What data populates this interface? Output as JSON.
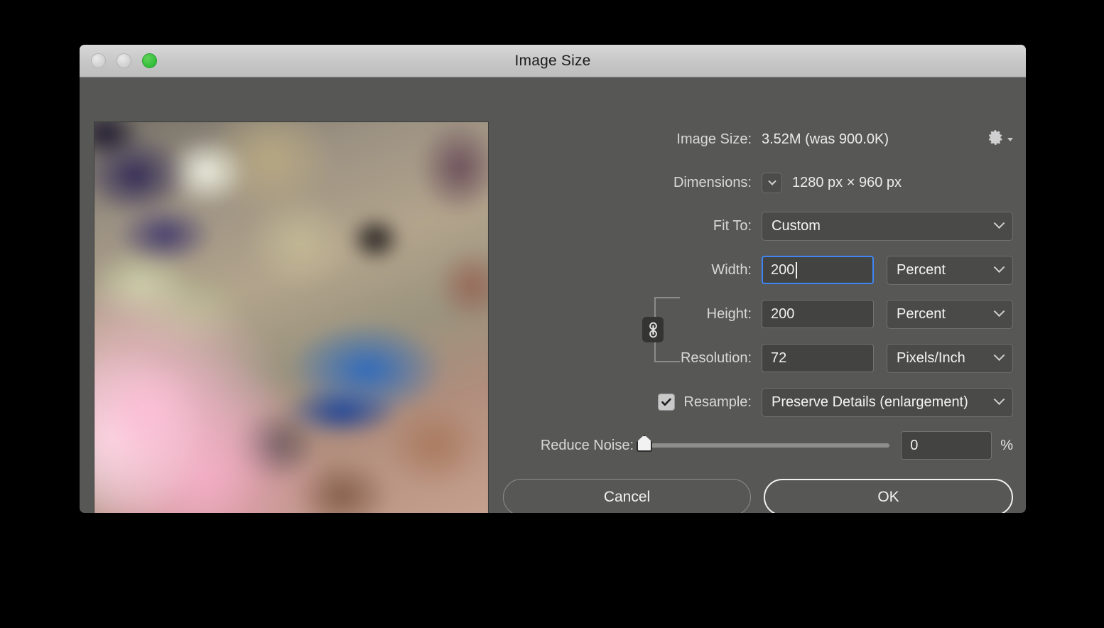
{
  "window": {
    "title": "Image Size",
    "traffic_lights": [
      {
        "name": "close",
        "state": "disabled"
      },
      {
        "name": "minimize",
        "state": "disabled"
      },
      {
        "name": "zoom",
        "state": "green"
      }
    ]
  },
  "info": {
    "image_size_label": "Image Size:",
    "image_size_value": "3.52M (was 900.0K)",
    "dimensions_label": "Dimensions:",
    "dimensions_value": "1280 px  ×  960 px",
    "gear_icon": "gear-icon"
  },
  "form": {
    "fit_to_label": "Fit To:",
    "fit_to_value": "Custom",
    "width_label": "Width:",
    "width_value": "200",
    "width_unit": "Percent",
    "height_label": "Height:",
    "height_value": "200",
    "height_unit": "Percent",
    "resolution_label": "Resolution:",
    "resolution_value": "72",
    "resolution_unit": "Pixels/Inch",
    "resample_label": "Resample:",
    "resample_value": "Preserve Details (enlargement)",
    "resample_checked": true,
    "reduce_noise_label": "Reduce Noise:",
    "reduce_noise_value": "0",
    "reduce_noise_percent_symbol": "%",
    "link_icon": "chain-link-icon"
  },
  "buttons": {
    "cancel": "Cancel",
    "ok": "OK"
  },
  "colors": {
    "dialog_bg": "#575756",
    "titlebar_bg": "#c8c8c8",
    "focus_border": "#3f86f2",
    "field_bg": "#434342",
    "select_bg": "#4a4a49",
    "text": "#ececec",
    "green_light": "#32bf3a"
  }
}
